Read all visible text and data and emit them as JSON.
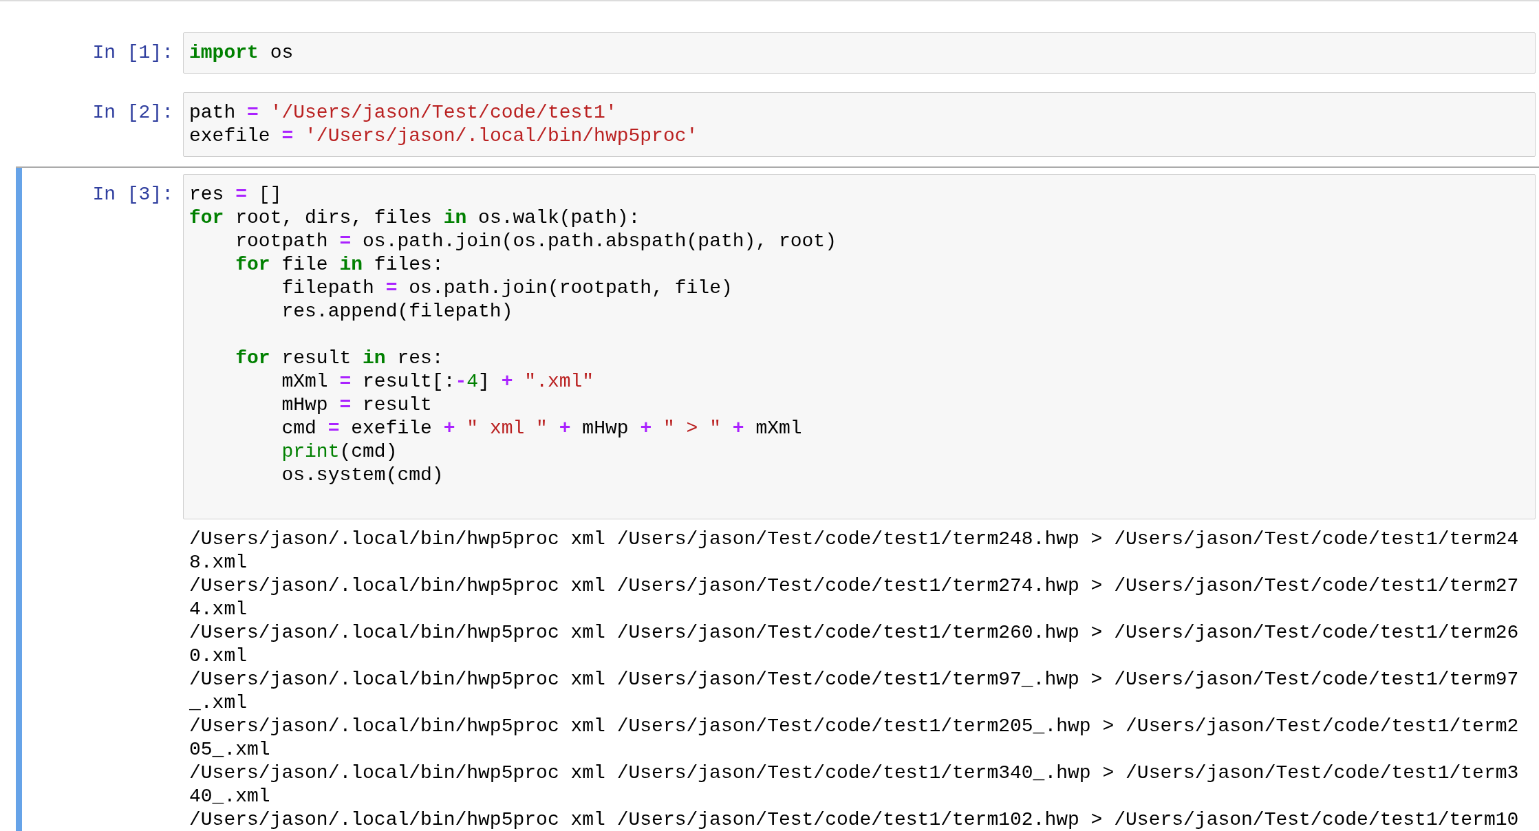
{
  "cells": [
    {
      "prompt": "In [1]:",
      "selected": false,
      "code": [
        {
          "kind": "code",
          "tokens": [
            {
              "kind": "kw",
              "text": "import"
            },
            {
              "kind": "text",
              "text": " os"
            }
          ]
        }
      ]
    },
    {
      "prompt": "In [2]:",
      "selected": false,
      "code": [
        {
          "kind": "code",
          "tokens": [
            {
              "kind": "text",
              "text": "path "
            },
            {
              "kind": "op",
              "text": "="
            },
            {
              "kind": "str",
              "text": " '/Users/jason/Test/code/test1'"
            }
          ]
        },
        {
          "kind": "code",
          "tokens": [
            {
              "kind": "text",
              "text": "exefile "
            },
            {
              "kind": "op",
              "text": "="
            },
            {
              "kind": "str",
              "text": " '/Users/jason/.local/bin/hwp5proc'"
            }
          ]
        }
      ]
    },
    {
      "prompt": "In [3]:",
      "selected": true,
      "code": [
        {
          "kind": "code",
          "tokens": [
            {
              "kind": "text",
              "text": "res "
            },
            {
              "kind": "op",
              "text": "="
            },
            {
              "kind": "text",
              "text": " []"
            }
          ]
        },
        {
          "kind": "code",
          "tokens": [
            {
              "kind": "kw",
              "text": "for"
            },
            {
              "kind": "text",
              "text": " root, dirs, files "
            },
            {
              "kind": "kw",
              "text": "in"
            },
            {
              "kind": "text",
              "text": " os.walk(path):"
            }
          ]
        },
        {
          "kind": "code",
          "tokens": [
            {
              "kind": "text",
              "text": "    rootpath "
            },
            {
              "kind": "op",
              "text": "="
            },
            {
              "kind": "text",
              "text": " os.path.join(os.path.abspath(path), root)"
            }
          ]
        },
        {
          "kind": "code",
          "tokens": [
            {
              "kind": "kw",
              "text": "    for"
            },
            {
              "kind": "text",
              "text": " file "
            },
            {
              "kind": "kw",
              "text": "in"
            },
            {
              "kind": "text",
              "text": " files:"
            }
          ]
        },
        {
          "kind": "code",
          "tokens": [
            {
              "kind": "text",
              "text": "        filepath "
            },
            {
              "kind": "op",
              "text": "="
            },
            {
              "kind": "text",
              "text": " os.path.join(rootpath, file)"
            }
          ]
        },
        {
          "kind": "code",
          "tokens": [
            {
              "kind": "text",
              "text": "        res.append(filepath)"
            }
          ]
        },
        {
          "kind": "blank"
        },
        {
          "kind": "code",
          "tokens": [
            {
              "kind": "kw",
              "text": "    for"
            },
            {
              "kind": "text",
              "text": " result "
            },
            {
              "kind": "kw",
              "text": "in"
            },
            {
              "kind": "text",
              "text": " res:"
            }
          ]
        },
        {
          "kind": "code",
          "tokens": [
            {
              "kind": "text",
              "text": "        mXml "
            },
            {
              "kind": "op",
              "text": "="
            },
            {
              "kind": "text",
              "text": " result[:"
            },
            {
              "kind": "op",
              "text": "-"
            },
            {
              "kind": "num",
              "text": "4"
            },
            {
              "kind": "text",
              "text": "] "
            },
            {
              "kind": "op",
              "text": "+"
            },
            {
              "kind": "str",
              "text": " \".xml\""
            }
          ]
        },
        {
          "kind": "code",
          "tokens": [
            {
              "kind": "text",
              "text": "        mHwp "
            },
            {
              "kind": "op",
              "text": "="
            },
            {
              "kind": "text",
              "text": " result"
            }
          ]
        },
        {
          "kind": "code",
          "tokens": [
            {
              "kind": "text",
              "text": "        cmd "
            },
            {
              "kind": "op",
              "text": "="
            },
            {
              "kind": "text",
              "text": " exefile "
            },
            {
              "kind": "op",
              "text": "+"
            },
            {
              "kind": "str",
              "text": " \" xml \" "
            },
            {
              "kind": "op",
              "text": "+"
            },
            {
              "kind": "text",
              "text": " mHwp "
            },
            {
              "kind": "op",
              "text": "+"
            },
            {
              "kind": "str",
              "text": " \" > \" "
            },
            {
              "kind": "op",
              "text": "+"
            },
            {
              "kind": "text",
              "text": " mXml"
            }
          ]
        },
        {
          "kind": "code",
          "tokens": [
            {
              "kind": "builtin",
              "text": "        print"
            },
            {
              "kind": "text",
              "text": "(cmd)"
            }
          ]
        },
        {
          "kind": "code",
          "tokens": [
            {
              "kind": "text",
              "text": "        os.system(cmd)"
            }
          ]
        },
        {
          "kind": "blank"
        }
      ],
      "output": [
        "/Users/jason/.local/bin/hwp5proc xml /Users/jason/Test/code/test1/term248.hwp > /Users/jason/Test/code/test1/term248.xml",
        "/Users/jason/.local/bin/hwp5proc xml /Users/jason/Test/code/test1/term274.hwp > /Users/jason/Test/code/test1/term274.xml",
        "/Users/jason/.local/bin/hwp5proc xml /Users/jason/Test/code/test1/term260.hwp > /Users/jason/Test/code/test1/term260.xml",
        "/Users/jason/.local/bin/hwp5proc xml /Users/jason/Test/code/test1/term97_.hwp > /Users/jason/Test/code/test1/term97_.xml",
        "/Users/jason/.local/bin/hwp5proc xml /Users/jason/Test/code/test1/term205_.hwp > /Users/jason/Test/code/test1/term205_.xml",
        "/Users/jason/.local/bin/hwp5proc xml /Users/jason/Test/code/test1/term340_.hwp > /Users/jason/Test/code/test1/term340_.xml",
        "/Users/jason/.local/bin/hwp5proc xml /Users/jason/Test/code/test1/term102.hwp > /Users/jason/Test/code/test1/term10"
      ]
    }
  ]
}
